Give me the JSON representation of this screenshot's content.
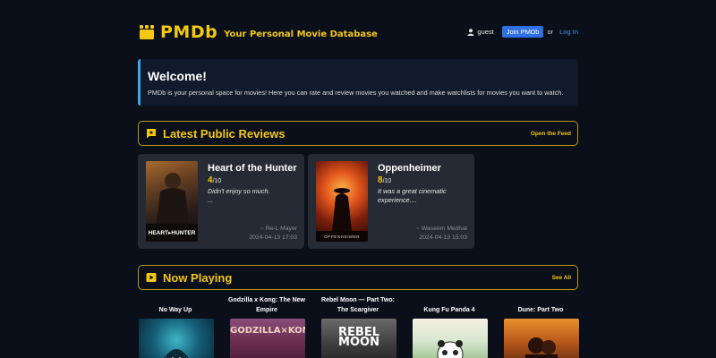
{
  "header": {
    "logo_text": "PMDb",
    "tagline": "Your Personal Movie Database",
    "user_name": "guest",
    "join_label": "Join PMDb",
    "or_text": "or",
    "login_label": "Log In"
  },
  "welcome": {
    "title": "Welcome!",
    "text": "PMDb is your personal space for movies! Here you can rate and review movies you watched and make watchlists for movies you want to watch."
  },
  "reviews_section": {
    "title": "Latest Public Reviews",
    "link": "Open the Feed",
    "cards": [
      {
        "title": "Heart of the Hunter",
        "rating": "4",
        "rating_max": "/10",
        "text": "Didn't enjoy so much.",
        "text_more": "...",
        "author": "~ Re-L Mayer",
        "date": "2024-04-13 17:03",
        "poster_label": "HEART▸HUNTER"
      },
      {
        "title": "Oppenheimer",
        "rating": "8",
        "rating_max": "/10",
        "text": "It was a great cinematic experience....",
        "text_more": "",
        "author": "~ Waseem Medhat",
        "date": "2024-04-13 15:03",
        "poster_label": "OPPENHEIMER"
      }
    ]
  },
  "now_playing": {
    "title": "Now Playing",
    "link": "See All",
    "items": [
      {
        "title": "No Way Up",
        "poster_label": ""
      },
      {
        "title": "Godzilla x Kong: The New Empire",
        "poster_label": "GODZILLA×KONG"
      },
      {
        "title": "Rebel Moon — Part Two: The Scargiver",
        "poster_label": "REBEL MOON"
      },
      {
        "title": "Kung Fu Panda 4",
        "poster_label": ""
      },
      {
        "title": "Dune: Part Two",
        "poster_label": ""
      }
    ]
  },
  "colors": {
    "background": "#0b0f19",
    "accent": "#f2c811",
    "link": "#4a90f0",
    "join_button": "#2f6fe4"
  }
}
